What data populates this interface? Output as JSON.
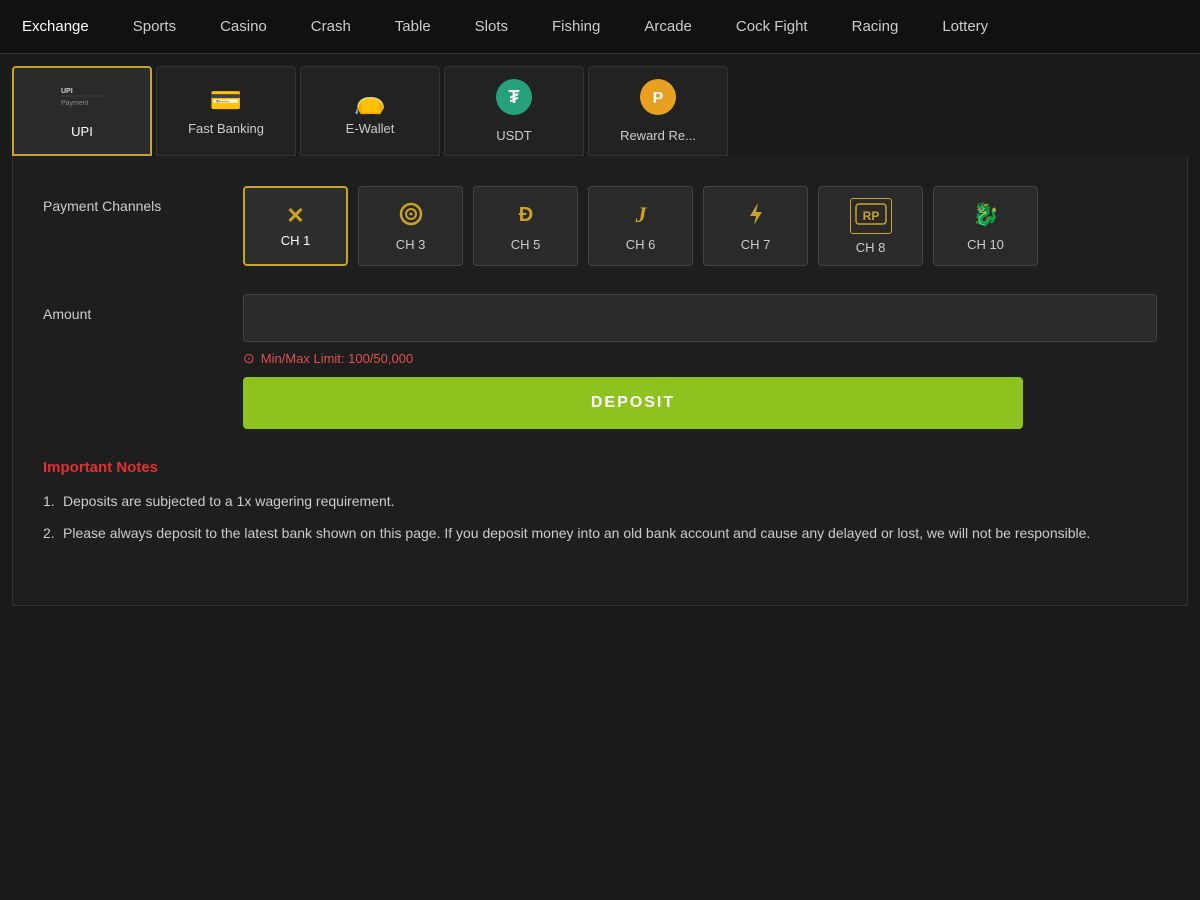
{
  "nav": {
    "items": [
      {
        "id": "exchange",
        "label": "Exchange"
      },
      {
        "id": "sports",
        "label": "Sports"
      },
      {
        "id": "casino",
        "label": "Casino"
      },
      {
        "id": "crash",
        "label": "Crash"
      },
      {
        "id": "table",
        "label": "Table"
      },
      {
        "id": "slots",
        "label": "Slots"
      },
      {
        "id": "fishing",
        "label": "Fishing"
      },
      {
        "id": "arcade",
        "label": "Arcade"
      },
      {
        "id": "cockfight",
        "label": "Cock Fight"
      },
      {
        "id": "racing",
        "label": "Racing"
      },
      {
        "id": "lottery",
        "label": "Lottery"
      }
    ]
  },
  "payment_tabs": [
    {
      "id": "upi",
      "label": "UPI",
      "icon": "UPI",
      "active": true
    },
    {
      "id": "fast-banking",
      "label": "Fast Banking",
      "icon": "💳"
    },
    {
      "id": "e-wallet",
      "label": "E-Wallet",
      "icon": "💼"
    },
    {
      "id": "usdt",
      "label": "USDT",
      "icon": "₮"
    },
    {
      "id": "reward",
      "label": "Reward Re...",
      "icon": "🪙"
    }
  ],
  "payment_channels": {
    "label": "Payment Channels",
    "channels": [
      {
        "id": "ch1",
        "label": "CH 1",
        "icon": "✕",
        "active": true
      },
      {
        "id": "ch3",
        "label": "CH 3",
        "icon": "◎"
      },
      {
        "id": "ch5",
        "label": "CH 5",
        "icon": "Ð"
      },
      {
        "id": "ch6",
        "label": "CH 6",
        "icon": "J"
      },
      {
        "id": "ch7",
        "label": "CH 7",
        "icon": "⚡"
      },
      {
        "id": "ch8",
        "label": "CH 8",
        "icon": "RP"
      },
      {
        "id": "ch10",
        "label": "CH 10",
        "icon": "🐉"
      }
    ]
  },
  "amount": {
    "label": "Amount",
    "placeholder": "",
    "limit_text": "Min/Max Limit: 100/50,000"
  },
  "deposit_button": {
    "label": "DEPOSIT"
  },
  "notes": {
    "title": "Important Notes",
    "items": [
      "Deposits are subjected to a 1x wagering requirement.",
      "Please always deposit to the latest bank shown on this page. If you deposit money into an old bank account and cause any delayed or lost, we will not be responsible."
    ]
  }
}
